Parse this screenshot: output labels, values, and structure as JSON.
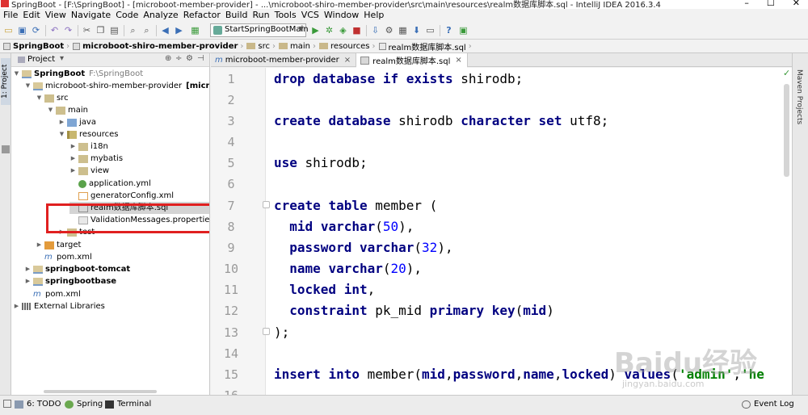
{
  "window": {
    "title": "SpringBoot - [F:\\SpringBoot] - [microboot-member-provider] - ...\\microboot-shiro-member-provider\\src\\main\\resources\\realm数据库脚本.sql - IntelliJ IDEA 2016.3.4"
  },
  "menu": [
    "File",
    "Edit",
    "View",
    "Navigate",
    "Code",
    "Analyze",
    "Refactor",
    "Build",
    "Run",
    "Tools",
    "VCS",
    "Window",
    "Help"
  ],
  "toolbar": {
    "run_config": "StartSpringBootMain"
  },
  "breadcrumb": [
    "SpringBoot",
    "microboot-shiro-member-provider",
    "src",
    "main",
    "resources",
    "realm数据库脚本.sql"
  ],
  "project_panel": {
    "title": "Project",
    "tree": [
      {
        "label": "SpringBoot",
        "sub": "F:\\SpringBoot",
        "bold": true,
        "icon": "module-folder",
        "toggle": "▼"
      },
      {
        "label": "microboot-shiro-member-provider",
        "sub": "[microboot",
        "bold": false,
        "icon": "module-folder",
        "toggle": "▼"
      },
      {
        "label": "src",
        "icon": "folder",
        "toggle": "▼"
      },
      {
        "label": "main",
        "icon": "folder",
        "toggle": "▼"
      },
      {
        "label": "java",
        "icon": "source-folder",
        "toggle": "▶"
      },
      {
        "label": "resources",
        "icon": "resources-folder",
        "toggle": "▼"
      },
      {
        "label": "i18n",
        "icon": "folder",
        "toggle": "▶"
      },
      {
        "label": "mybatis",
        "icon": "folder",
        "toggle": "▶"
      },
      {
        "label": "view",
        "icon": "folder",
        "toggle": "▶"
      },
      {
        "label": "application.yml",
        "icon": "yml-file",
        "toggle": ""
      },
      {
        "label": "generatorConfig.xml",
        "icon": "xml-file",
        "toggle": ""
      },
      {
        "label": "realm数据库脚本.sql",
        "icon": "sql-file",
        "toggle": "",
        "selected": true
      },
      {
        "label": "ValidationMessages.properties",
        "icon": "properties-file",
        "toggle": ""
      },
      {
        "label": "test",
        "icon": "folder",
        "toggle": "▶"
      },
      {
        "label": "target",
        "icon": "target-folder",
        "toggle": "▶"
      },
      {
        "label": "pom.xml",
        "icon": "pom-file",
        "toggle": ""
      },
      {
        "label": "springboot-tomcat",
        "bold": true,
        "icon": "module-folder",
        "toggle": "▶"
      },
      {
        "label": "springbootbase",
        "bold": true,
        "icon": "module-folder",
        "toggle": "▶"
      },
      {
        "label": "pom.xml",
        "icon": "pom-file",
        "toggle": ""
      },
      {
        "label": "External Libraries",
        "icon": "library",
        "toggle": "▶"
      }
    ]
  },
  "tabs": [
    {
      "label": "microboot-member-provider",
      "active": false
    },
    {
      "label": "realm数据库脚本.sql",
      "active": true
    }
  ],
  "editor": {
    "line_numbers": [
      "1",
      "2",
      "3",
      "4",
      "5",
      "6",
      "7",
      "8",
      "9",
      "10",
      "11",
      "12",
      "13",
      "14",
      "15",
      "16"
    ],
    "lines": [
      "drop database if exists shirodb;",
      "",
      "create database shirodb character set utf8;",
      "",
      "use shirodb;",
      "",
      "create table member (",
      "  mid varchar(50),",
      "  password varchar(32),",
      "  name varchar(20),",
      "  locked int,",
      "  constraint pk_mid primary key(mid)",
      ");",
      "",
      "insert into member(mid,password,name,locked) values('admin','he",
      ""
    ]
  },
  "right_panel": {
    "label": "Maven Projects"
  },
  "left_panel": {
    "label": "1: Project"
  },
  "status": {
    "todo": "6: TODO",
    "spring": "Spring",
    "terminal": "Terminal",
    "event_log": "Event Log"
  },
  "watermark": {
    "main": "Baidu经验",
    "sub": "jingyan.baidu.com"
  },
  "colors": {
    "keyword": "#000080",
    "number": "#0000ff",
    "string": "#008000",
    "highlight_box": "#e02020"
  }
}
